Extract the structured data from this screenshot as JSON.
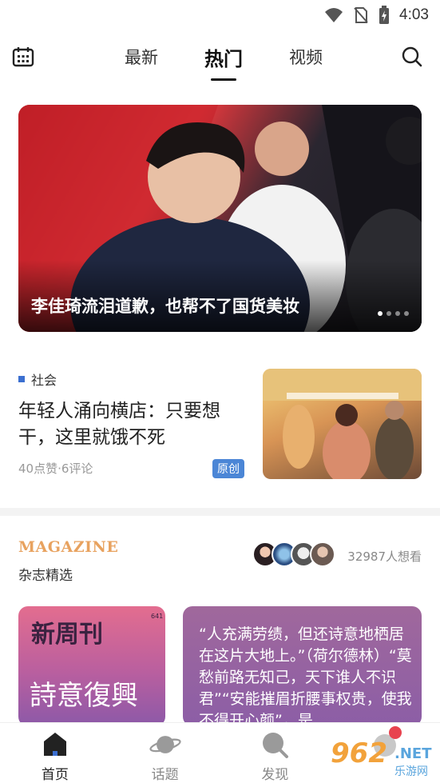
{
  "status_bar": {
    "time": "4:03"
  },
  "top_nav": {
    "tabs": [
      {
        "label": "最新"
      },
      {
        "label": "热门"
      },
      {
        "label": "视频"
      }
    ]
  },
  "hero": {
    "title": "李佳琦流泪道歉，也帮不了国货美妆",
    "slide_count": 4,
    "active_slide": 1
  },
  "article": {
    "tag": "社会",
    "title": "年轻人涌向横店：只要想干，这里就饿不死",
    "meta": "40点赞·6评论",
    "badge": "原创"
  },
  "magazine": {
    "logo": "MAGAZINE",
    "subtitle": "杂志精选",
    "want_count": "32987人想看",
    "cards": [
      {
        "masthead": "新周刊",
        "issue": "641",
        "cover_text": "詩意復興"
      },
      {
        "quote": "“人充满劳绩，但还诗意地栖居在这片大地上。”（荷尔德林）“莫愁前路无知己，天下谁人不识君”“安能摧眉折腰事权贵，使我不得开心颜”，是"
      }
    ]
  },
  "bottom_nav": {
    "items": [
      {
        "label": "首页"
      },
      {
        "label": "话题"
      },
      {
        "label": "发现"
      },
      {
        "label": ""
      }
    ]
  },
  "watermark": {
    "number": "962",
    "net": ".NET",
    "sub": "乐游网"
  },
  "colors": {
    "accent_blue": "#4b86d6",
    "magazine_orange": "#e8a25f",
    "notification_red": "#e8434f"
  }
}
